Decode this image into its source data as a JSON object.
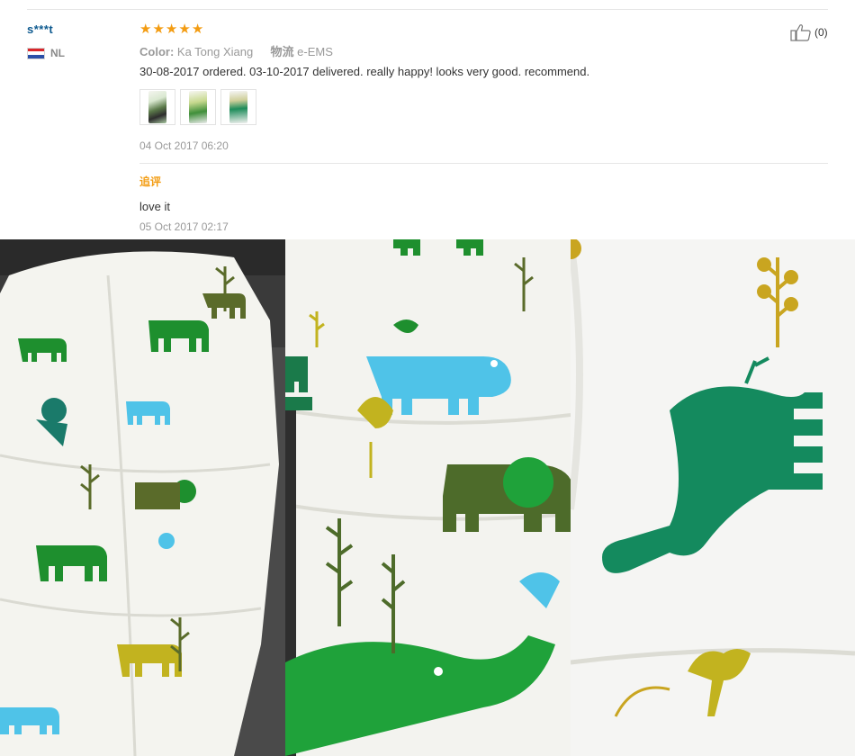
{
  "review": {
    "user_name": "s***t",
    "country_code": "NL",
    "rating": 5,
    "stars": [
      "★",
      "★",
      "★",
      "★",
      "★"
    ],
    "color_label": "Color:",
    "color_value": "Ka Tong Xiang",
    "shipping_label": "物流",
    "shipping_value": "e-EMS",
    "text": "30-08-2017 ordered. 03-10-2017 delivered. really happy! looks very good. recommend.",
    "date": "04 Oct 2017 06:20",
    "helpful_count": "(0)",
    "thumbnails": [
      "thumb-1",
      "thumb-2",
      "thumb-3"
    ]
  },
  "followup": {
    "label": "追评",
    "text": "love it",
    "date": "05 Oct 2017 02:17"
  },
  "icons": {
    "helpful": "thumbs-up-icon",
    "flag": "netherlands-flag-icon"
  },
  "colors": {
    "user": "#0e5a8f",
    "star": "#f39c12",
    "followup_label": "#f39c12",
    "meta": "#999999"
  }
}
